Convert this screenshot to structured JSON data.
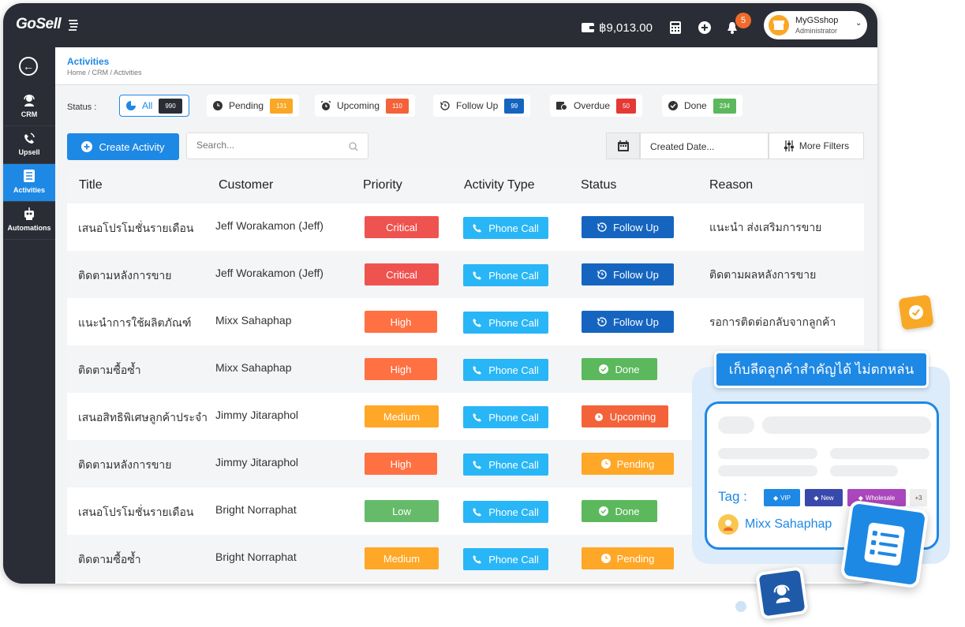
{
  "topbar": {
    "logo": "GoSell",
    "balance": "฿9,013.00",
    "notification_count": "5",
    "user_name": "MyGSshop",
    "user_role": "Administrator"
  },
  "sidebar": {
    "items": [
      {
        "label": "CRM",
        "icon": "headset-icon"
      },
      {
        "label": "Upsell",
        "icon": "phone-ring-icon"
      },
      {
        "label": "Activities",
        "icon": "list-icon"
      },
      {
        "label": "Automations",
        "icon": "robot-icon"
      }
    ]
  },
  "page": {
    "title": "Activities",
    "breadcrumb": "Home / CRM / Activities"
  },
  "status_filter": {
    "label": "Status :",
    "chips": [
      {
        "label": "All",
        "count": "990",
        "color": "#2a2d35"
      },
      {
        "label": "Pending",
        "count": "131",
        "color": "#f9a825"
      },
      {
        "label": "Upcoming",
        "count": "110",
        "color": "#f4623a"
      },
      {
        "label": "Follow Up",
        "count": "99",
        "color": "#1565c0"
      },
      {
        "label": "Overdue",
        "count": "50",
        "color": "#e53935"
      },
      {
        "label": "Done",
        "count": "234",
        "color": "#5cb85c"
      }
    ]
  },
  "toolbar": {
    "create_label": "Create Activity",
    "search_placeholder": "Search...",
    "date_placeholder": "Created Date...",
    "filters_label": "More Filters"
  },
  "table": {
    "headers": [
      "Title",
      "Customer",
      "Priority",
      "Activity Type",
      "Status",
      "Reason"
    ],
    "rows": [
      {
        "title": "เสนอโปรโมชั่นรายเดือน",
        "customer": "Jeff Worakamon (Jeff)",
        "priority": "Critical",
        "type": "Phone Call",
        "status": "Follow Up",
        "reason": "แนะนำ ส่งเสริมการขาย"
      },
      {
        "title": "ติดตามหลังการขาย",
        "customer": "Jeff Worakamon (Jeff)",
        "priority": "Critical",
        "type": "Phone Call",
        "status": "Follow Up",
        "reason": "ติดตามผลหลังการขาย"
      },
      {
        "title": "แนะนำการใช้ผลิตภัณฑ์",
        "customer": "Mixx Sahaphap",
        "priority": "High",
        "type": "Phone Call",
        "status": "Follow Up",
        "reason": "รอการติดต่อกลับจากลูกค้า"
      },
      {
        "title": "ติดตามซื้อซ้ำ",
        "customer": "Mixx Sahaphap",
        "priority": "High",
        "type": "Phone Call",
        "status": "Done",
        "reason": ""
      },
      {
        "title": "เสนอสิทธิพิเศษลูกค้าประจำ",
        "customer": "Jimmy Jitaraphol",
        "priority": "Medium",
        "type": "Phone Call",
        "status": "Upcoming",
        "reason": ""
      },
      {
        "title": "ติดตามหลังการขาย",
        "customer": "Jimmy Jitaraphol",
        "priority": "High",
        "type": "Phone Call",
        "status": "Pending",
        "reason": ""
      },
      {
        "title": "เสนอโปรโมชั่นรายเดือน",
        "customer": "Bright Norraphat",
        "priority": "Low",
        "type": "Phone Call",
        "status": "Done",
        "reason": ""
      },
      {
        "title": "ติดตามซื้อซ้ำ",
        "customer": "Bright Norraphat",
        "priority": "Medium",
        "type": "Phone Call",
        "status": "Pending",
        "reason": ""
      }
    ]
  },
  "colors": {
    "accent": "#1e88e5",
    "dark": "#2a2d35",
    "critical": "#ef5350",
    "high": "#ff7043",
    "medium": "#ffa726",
    "low": "#66bb6a",
    "phone": "#29b6f6",
    "follow_up": "#1565c0",
    "done": "#5cb85c",
    "upcoming": "#f4623a",
    "pending": "#ffa726"
  },
  "promo": {
    "banner": "เก็บลีดลูกค้าสำคัญได้ ไม่ตกหล่น",
    "tag_label": "Tag :",
    "tags": [
      {
        "label": "VIP",
        "color": "#1e88e5"
      },
      {
        "label": "New",
        "color": "#3949ab"
      },
      {
        "label": "Wholesale",
        "color": "#ab47bc"
      }
    ],
    "tag_more": "+3",
    "customer": "Mixx Sahaphap"
  }
}
